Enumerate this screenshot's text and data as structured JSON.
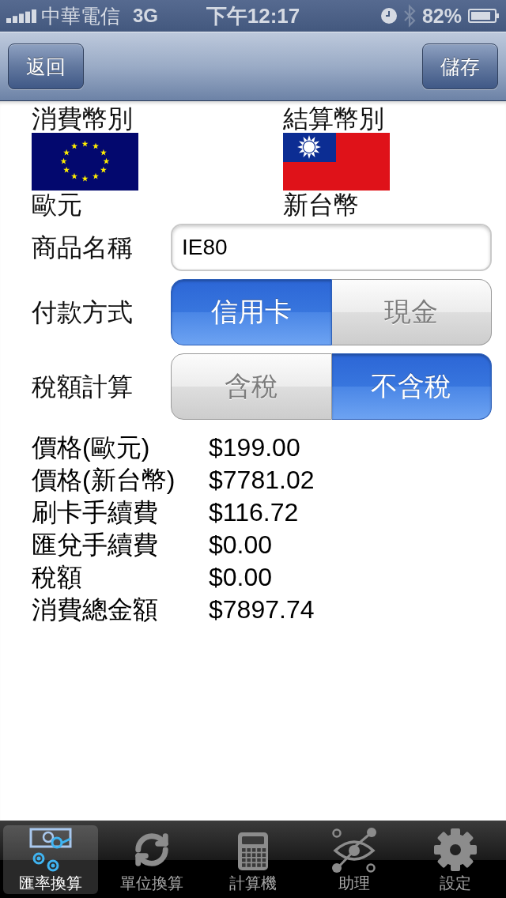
{
  "status_bar": {
    "carrier": "中華電信",
    "network": "3G",
    "time": "下午12:17",
    "battery": "82%"
  },
  "nav_bar": {
    "back_button": "返回",
    "save_button": "儲存"
  },
  "currencies": [
    {
      "label": "消費幣別",
      "kind": "eu",
      "name": "歐元"
    },
    {
      "label": "結算幣別",
      "kind": "tw",
      "name": "新台幣"
    }
  ],
  "product_name": {
    "label": "商品名稱",
    "value": "IE80"
  },
  "segments": [
    {
      "label": "付款方式",
      "options": [
        {
          "label": "信用卡",
          "selected": true
        },
        {
          "label": "現金",
          "selected": false
        }
      ]
    },
    {
      "label": "稅額計算",
      "options": [
        {
          "label": "含稅",
          "selected": false
        },
        {
          "label": "不含稅",
          "selected": true
        }
      ]
    }
  ],
  "results": [
    {
      "label": "價格(歐元)",
      "value": "$199.00"
    },
    {
      "label": "價格(新台幣)",
      "value": "$7781.02"
    },
    {
      "label": "刷卡手續費",
      "value": "$116.72"
    },
    {
      "label": "匯兌手續費",
      "value": "$0.00"
    },
    {
      "label": "稅額",
      "value": "$0.00"
    },
    {
      "label": "消費總金額",
      "value": "$7897.74"
    }
  ],
  "tab_bar": {
    "items": [
      {
        "label": "匯率換算",
        "kind": "exchange",
        "selected": true
      },
      {
        "label": "單位換算",
        "kind": "convert",
        "selected": false
      },
      {
        "label": "計算機",
        "kind": "calculator",
        "selected": false
      },
      {
        "label": "助理",
        "kind": "assistant",
        "selected": false
      },
      {
        "label": "設定",
        "kind": "settings",
        "selected": false
      }
    ]
  }
}
